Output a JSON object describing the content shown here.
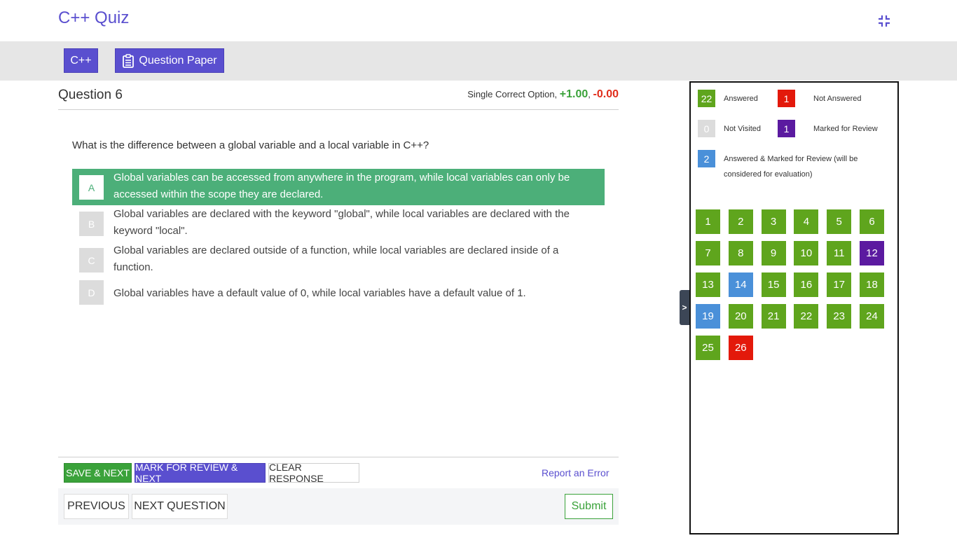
{
  "header": {
    "title": "C++ Quiz",
    "collapse_icon": "collapse-icon"
  },
  "sections": {
    "cpp_label": "C++",
    "question_paper_label": "Question Paper"
  },
  "question": {
    "title": "Question 6",
    "type_label": "Single Correct Option,",
    "positive": "+1.00",
    "comma": ",",
    "negative": "-0.00",
    "text": "What is the difference between a global variable and a local variable in C++?",
    "options": [
      {
        "letter": "A",
        "text": "Global variables can be accessed from anywhere in the program, while local variables can only be accessed within the scope they are declared."
      },
      {
        "letter": "B",
        "text": "Global variables are declared with the keyword \"global\", while local variables are declared with the keyword \"local\"."
      },
      {
        "letter": "C",
        "text": "Global variables are declared outside of a function, while local variables are declared inside of a function."
      },
      {
        "letter": "D",
        "text": "Global variables have a default value of 0, while local variables have a default value of 1."
      }
    ],
    "selected": "A"
  },
  "actions": {
    "save_next": "SAVE & NEXT",
    "mark_review_next": "MARK FOR REVIEW & NEXT",
    "clear_response": "CLEAR RESPONSE",
    "report_error": "Report an Error",
    "previous": "PREVIOUS",
    "next_question": "NEXT QUESTION",
    "submit": "Submit"
  },
  "side_toggle": ">",
  "legend": {
    "answered": {
      "count": "22",
      "label": "Answered",
      "color": "#5fa51d"
    },
    "not_answered": {
      "count": "1",
      "label": "Not Answered",
      "color": "#e3190b"
    },
    "not_visited": {
      "count": "0",
      "label": "Not Visited",
      "color": "#dcdcdc"
    },
    "marked_review": {
      "count": "1",
      "label": "Marked for Review",
      "color": "#5b1aa0"
    },
    "answered_marked": {
      "count": "2",
      "label_line1": "Answered & Marked for Review (will be",
      "label_line2": "considered for evaluation)",
      "color": "#4a90d9"
    }
  },
  "palette": [
    {
      "n": "1",
      "status": "answered"
    },
    {
      "n": "2",
      "status": "answered"
    },
    {
      "n": "3",
      "status": "answered"
    },
    {
      "n": "4",
      "status": "answered"
    },
    {
      "n": "5",
      "status": "answered"
    },
    {
      "n": "6",
      "status": "answered"
    },
    {
      "n": "7",
      "status": "answered"
    },
    {
      "n": "8",
      "status": "answered"
    },
    {
      "n": "9",
      "status": "answered"
    },
    {
      "n": "10",
      "status": "answered"
    },
    {
      "n": "11",
      "status": "answered"
    },
    {
      "n": "12",
      "status": "marked"
    },
    {
      "n": "13",
      "status": "answered"
    },
    {
      "n": "14",
      "status": "answered_marked"
    },
    {
      "n": "15",
      "status": "answered"
    },
    {
      "n": "16",
      "status": "answered"
    },
    {
      "n": "17",
      "status": "answered"
    },
    {
      "n": "18",
      "status": "answered"
    },
    {
      "n": "19",
      "status": "answered_marked"
    },
    {
      "n": "20",
      "status": "answered"
    },
    {
      "n": "21",
      "status": "answered"
    },
    {
      "n": "22",
      "status": "answered"
    },
    {
      "n": "23",
      "status": "answered"
    },
    {
      "n": "24",
      "status": "answered"
    },
    {
      "n": "25",
      "status": "answered"
    },
    {
      "n": "26",
      "status": "not_answered"
    }
  ]
}
